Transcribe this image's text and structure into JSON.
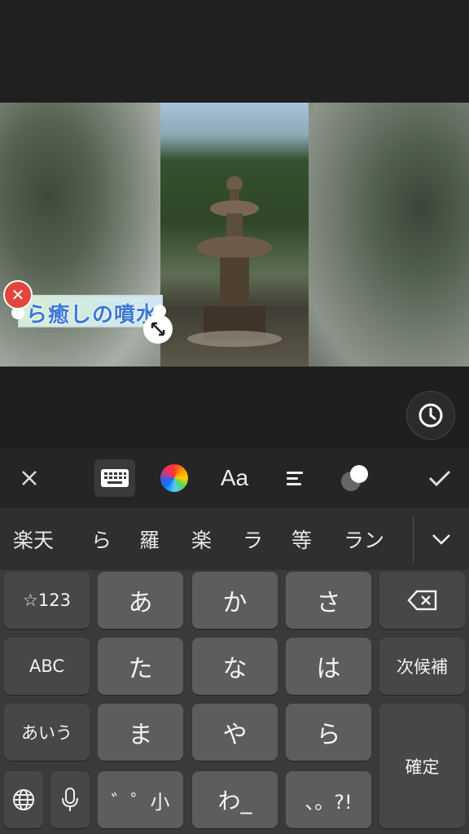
{
  "preview": {
    "text_sticker": "ら癒しの噴水"
  },
  "toolbar": {
    "tools": [
      "close-icon",
      "keyboard-icon",
      "color-wheel-icon",
      "Aa",
      "align-icon",
      "opacity-icon",
      "check-icon"
    ],
    "font_label": "Aa"
  },
  "keyboard": {
    "candidates": [
      "楽天",
      "ら",
      "羅",
      "楽",
      "ラ",
      "等",
      "ラン"
    ],
    "rows": [
      [
        "☆123",
        "あ",
        "か",
        "さ",
        "⌫"
      ],
      [
        "ABC",
        "た",
        "な",
        "は",
        "次候補"
      ],
      [
        "あいう",
        "ま",
        "や",
        "ら",
        "確定"
      ],
      [
        "globe",
        "mic",
        "゛゜小",
        "わ_",
        "、。?!"
      ]
    ],
    "key_labels": {
      "num": "☆123",
      "a": "あ",
      "ka": "か",
      "sa": "さ",
      "abc": "ABC",
      "ta": "た",
      "na": "な",
      "ha": "は",
      "next": "次候補",
      "kana": "あいう",
      "ma": "ま",
      "ya": "や",
      "ra": "ら",
      "confirm": "確定",
      "dakuten": "゛゜小",
      "wa": "わ_",
      "punct": "、。?!"
    }
  }
}
